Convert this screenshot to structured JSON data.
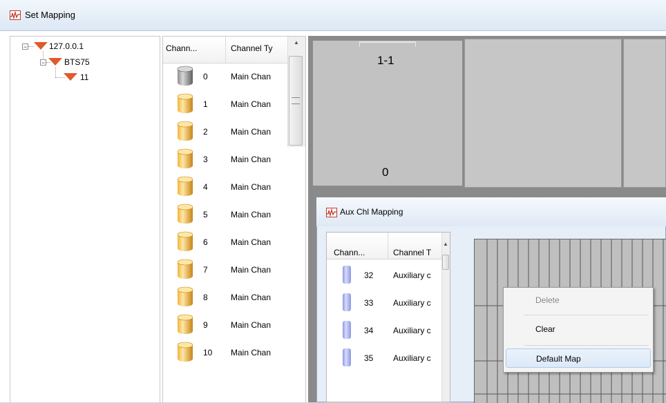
{
  "window": {
    "title": "Set Mapping",
    "icon": "waveform-app-icon"
  },
  "tree": {
    "nodes": [
      {
        "label": "127.0.0.1",
        "expanded": true,
        "icon": "server-triangle-icon"
      },
      {
        "label": "BTS75",
        "expanded": true,
        "icon": "device-triangle-icon"
      },
      {
        "label": "11",
        "icon": "unit-triangle-icon"
      }
    ]
  },
  "channel_list": {
    "columns": [
      "Chann...",
      "Channel Ty"
    ],
    "rows": [
      {
        "num": "0",
        "type": "Main Chan",
        "state": "gray"
      },
      {
        "num": "1",
        "type": "Main Chan",
        "state": "orange"
      },
      {
        "num": "2",
        "type": "Main Chan",
        "state": "orange"
      },
      {
        "num": "3",
        "type": "Main Chan",
        "state": "orange"
      },
      {
        "num": "4",
        "type": "Main Chan",
        "state": "orange"
      },
      {
        "num": "5",
        "type": "Main Chan",
        "state": "orange"
      },
      {
        "num": "6",
        "type": "Main Chan",
        "state": "orange"
      },
      {
        "num": "7",
        "type": "Main Chan",
        "state": "orange"
      },
      {
        "num": "8",
        "type": "Main Chan",
        "state": "orange"
      },
      {
        "num": "9",
        "type": "Main Chan",
        "state": "orange"
      },
      {
        "num": "10",
        "type": "Main Chan",
        "state": "orange"
      }
    ]
  },
  "grid": {
    "cell_1_1": {
      "title": "1-1",
      "value": "0"
    }
  },
  "aux_dialog": {
    "title": "Aux Chl Mapping",
    "columns": [
      "Chann...",
      "Channel T"
    ],
    "rows": [
      {
        "num": "32",
        "type": "Auxiliary c"
      },
      {
        "num": "33",
        "type": "Auxiliary c"
      },
      {
        "num": "34",
        "type": "Auxiliary c"
      },
      {
        "num": "35",
        "type": "Auxiliary c"
      }
    ]
  },
  "context_menu": {
    "items": [
      {
        "label": "Delete",
        "enabled": false
      },
      {
        "label": "Clear",
        "enabled": true
      },
      {
        "label": "Default Map",
        "enabled": true,
        "highlighted": true
      }
    ]
  },
  "colors": {
    "accent_orange": "#e8a33a",
    "tree_triangle": "#e05a2a",
    "aux_blue": "#aab4ee",
    "menu_disabled": "#888888"
  }
}
